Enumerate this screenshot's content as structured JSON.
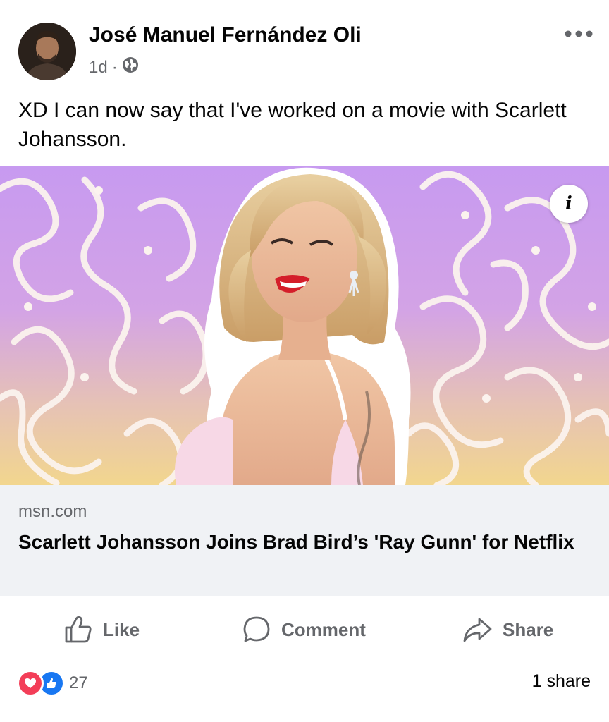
{
  "post": {
    "author": "José Manuel Fernández Oli",
    "time": "1d",
    "separator": "·",
    "privacy_icon": "globe-icon",
    "more_icon": "more-dots-icon",
    "text": "XD I can now say that I've worked on a movie with Scarlett Johansson."
  },
  "link_preview": {
    "info_icon": "info-icon",
    "info_glyph": "i",
    "domain": "msn.com",
    "title": "Scarlett Johansson Joins Brad Bird’s 'Ray Gunn' for Netflix"
  },
  "actions": {
    "like": {
      "label": "Like",
      "icon": "thumbs-up-icon"
    },
    "comment": {
      "label": "Comment",
      "icon": "comment-icon"
    },
    "share": {
      "label": "Share",
      "icon": "share-arrow-icon"
    }
  },
  "footer": {
    "reaction_icons": [
      "love-reaction-icon",
      "like-reaction-icon"
    ],
    "reaction_count": "27",
    "share_count": "1 share"
  },
  "colors": {
    "text_primary": "#050505",
    "text_secondary": "#65676b",
    "link_background": "#f0f2f5",
    "like_blue": "#1877f2",
    "love_red": "#f33e58"
  }
}
